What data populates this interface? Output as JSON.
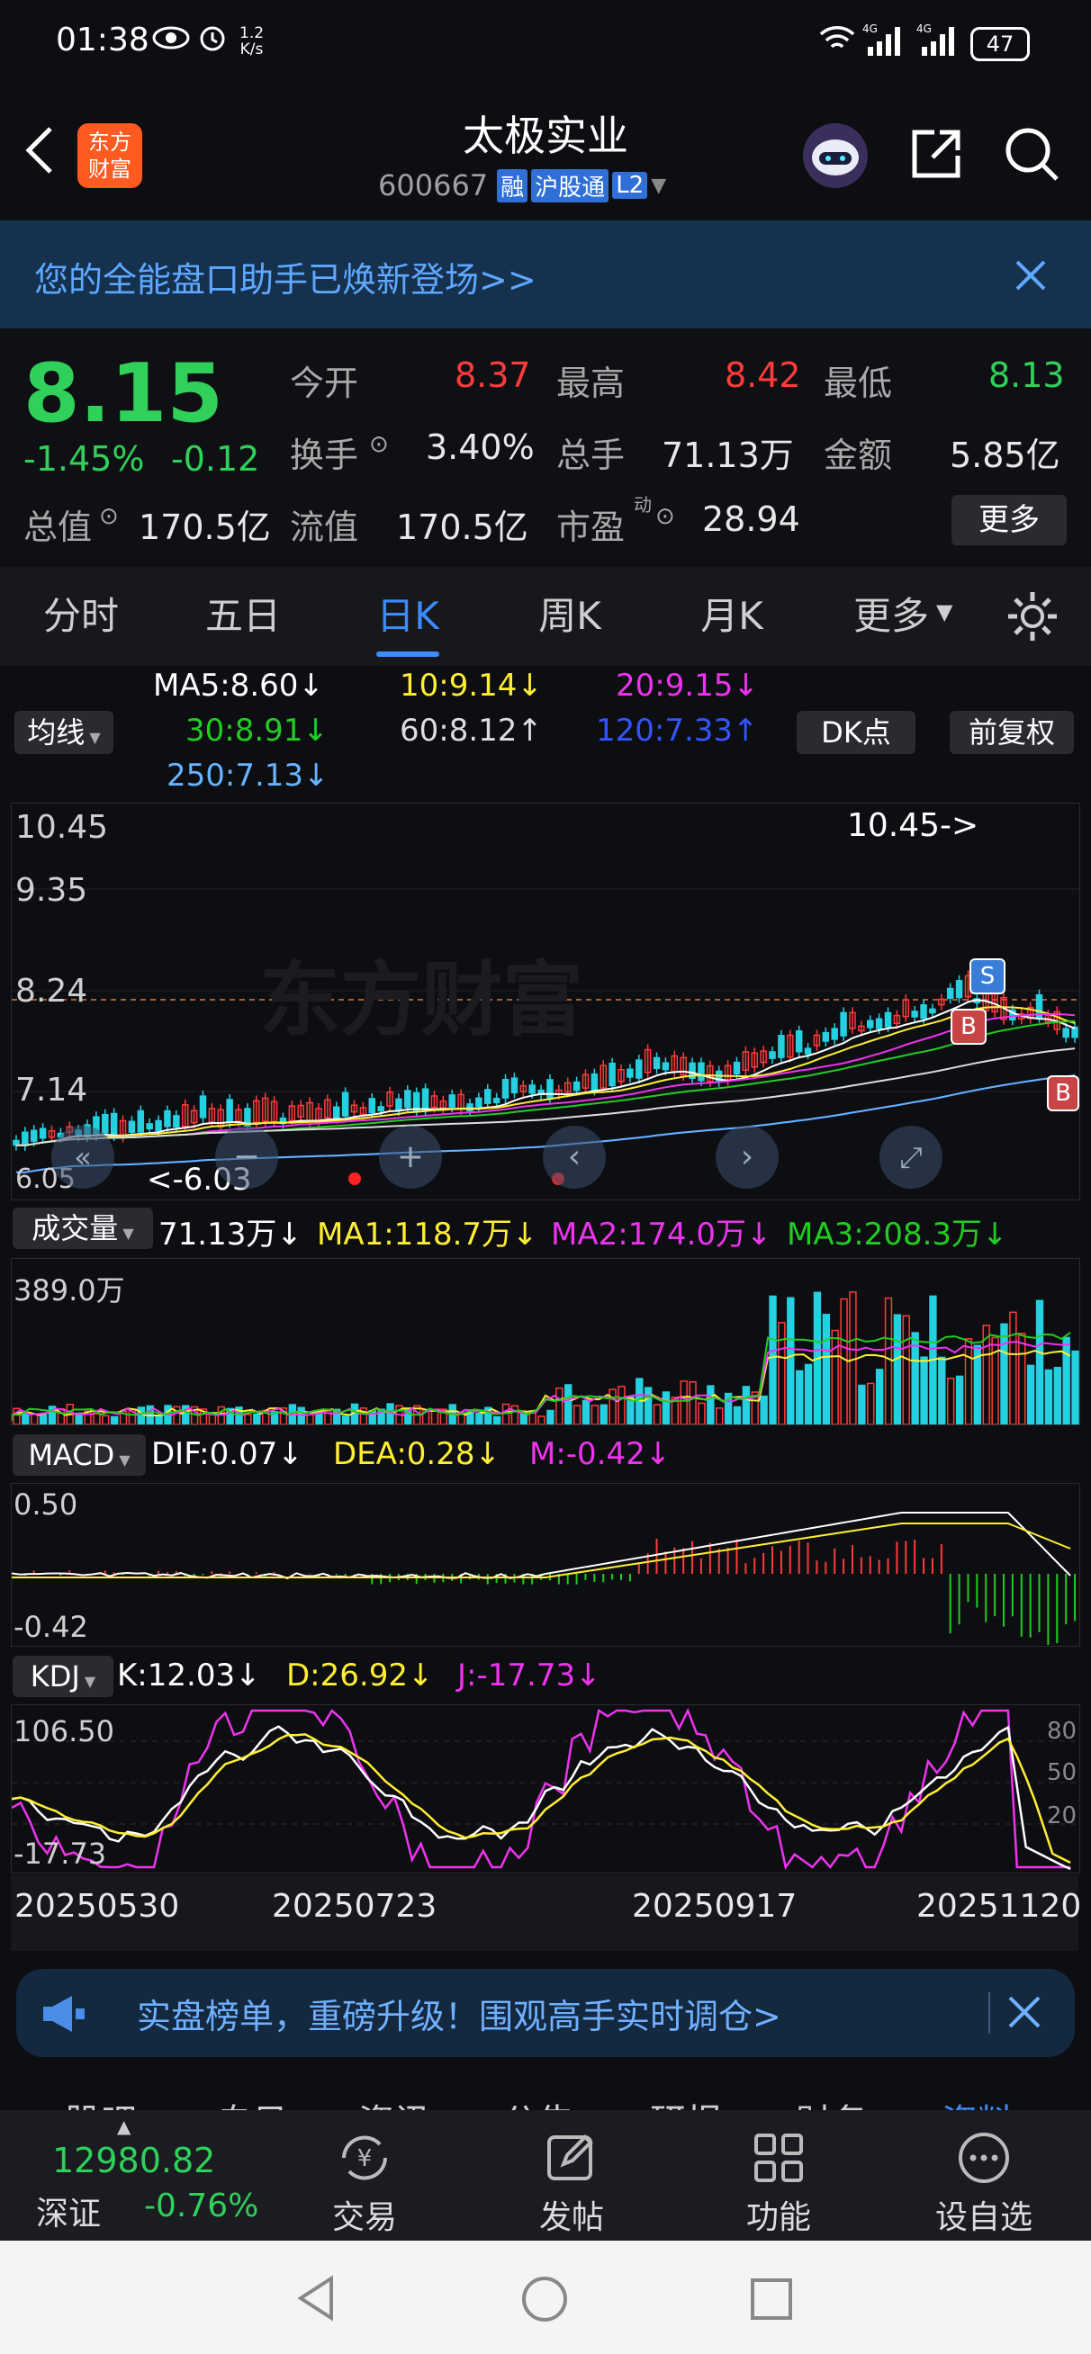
{
  "status": {
    "time": "01:38",
    "speed_top": "1.2",
    "speed_bottom": "K/s",
    "battery": "47"
  },
  "header": {
    "title": "太极实业",
    "code": "600667",
    "tag_rong": "融",
    "tag_hgt": "沪股通",
    "tag_l2": "L2",
    "logo_top": "东方",
    "logo_bottom": "财富"
  },
  "banner": {
    "text": "您的全能盘口助手已焕新登场>>"
  },
  "quote": {
    "price": "8.15",
    "change_pct": "-1.45%",
    "change_abs": "-0.12",
    "open_label": "今开",
    "open": "8.37",
    "high_label": "最高",
    "high": "8.42",
    "low_label": "最低",
    "low": "8.13",
    "turnover_label": "换手",
    "turnover": "3.40%",
    "volume_label": "总手",
    "volume": "71.13万",
    "amount_label": "金额",
    "amount": "5.85亿",
    "mktcap_label": "总值",
    "mktcap": "170.5亿",
    "float_label": "流值",
    "float": "170.5亿",
    "pe_label": "市盈",
    "pe_sup": "动",
    "pe": "28.94",
    "more": "更多"
  },
  "tabs": [
    "分时",
    "五日",
    "日K",
    "周K",
    "月K",
    "更多"
  ],
  "ma": {
    "btn": "均线",
    "ma5": "MA5:8.60↓",
    "ma10": "10:9.14↓",
    "ma20": "20:9.15↓",
    "ma30": "30:8.91↓",
    "ma60": "60:8.12↑",
    "ma120": "120:7.33↑",
    "ma250": "250:7.13↓",
    "dk": "DK点",
    "fq": "前复权"
  },
  "kline": {
    "y_top": "10.45",
    "y2": "9.35",
    "y3": "8.24",
    "y4": "7.14",
    "y5": "6.05",
    "high_mark": "10.45->",
    "low_mark": "<-6.03",
    "watermark": "东方财富"
  },
  "vol": {
    "btn": "成交量",
    "v": "71.13万↓",
    "ma1": "MA1:118.7万↓",
    "ma2": "MA2:174.0万↓",
    "ma3": "MA3:208.3万↓",
    "y_top": "389.0万"
  },
  "macd": {
    "btn": "MACD",
    "dif": "DIF:0.07↓",
    "dea": "DEA:0.28↓",
    "m": "M:-0.42↓",
    "y_top": "0.50",
    "y_bot": "-0.42"
  },
  "kdj": {
    "btn": "KDJ",
    "k": "K:12.03↓",
    "d": "D:26.92↓",
    "j": "J:-17.73↓",
    "y_top": "106.50",
    "y_bot": "-17.73",
    "r80": "80",
    "r50": "50",
    "r20": "20"
  },
  "dates": [
    "20250530",
    "20250723",
    "20250917",
    "20251120"
  ],
  "promo": {
    "text": "实盘榜单，重磅升级！围观高手实时调仓>"
  },
  "subtabs": [
    "股吧",
    "自日",
    "资讯",
    "公告",
    "研报",
    "财务",
    "资料"
  ],
  "bottom": {
    "index": "12980.82",
    "index_name": "深证",
    "index_chg": "-0.76%",
    "trade": "交易",
    "post": "发帖",
    "func": "功能",
    "custom": "设自选"
  },
  "colors": {
    "up": "#ff3b3b",
    "down": "#2fd15a",
    "accent": "#3d8bfd"
  }
}
